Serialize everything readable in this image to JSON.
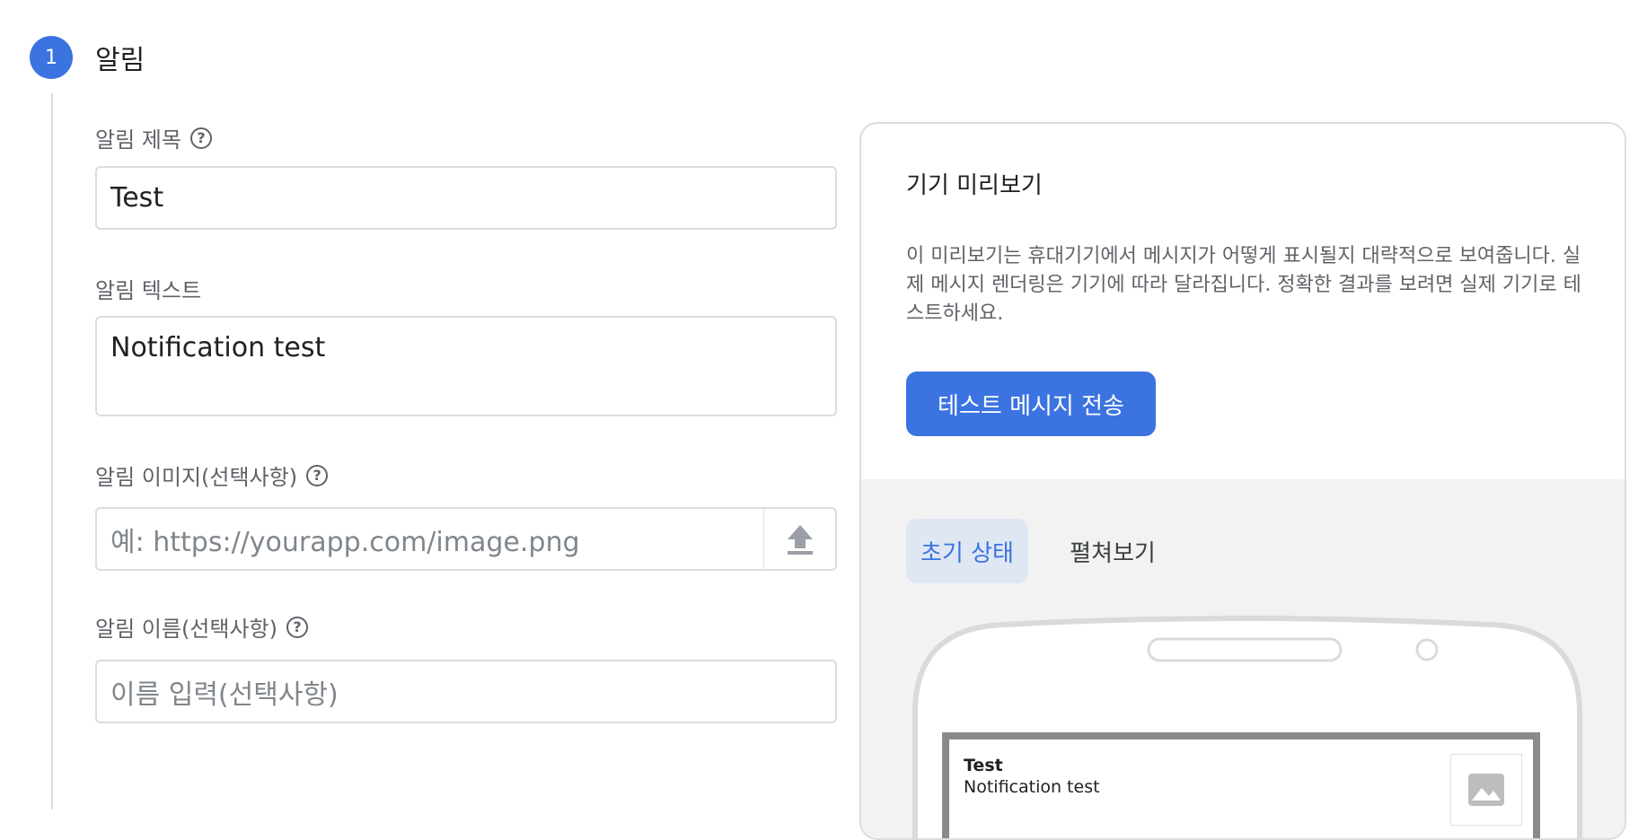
{
  "step": {
    "number": "1",
    "title": "알림"
  },
  "form": {
    "title_label": "알림 제목",
    "title_value": "Test",
    "text_label": "알림 텍스트",
    "text_value": "Notification test",
    "image_label": "알림 이미지(선택사항)",
    "image_placeholder": "예: https://yourapp.com/image.png",
    "name_label": "알림 이름(선택사항)",
    "name_placeholder": "이름 입력(선택사항)"
  },
  "preview": {
    "title": "기기 미리보기",
    "description": "이 미리보기는 휴대기기에서 메시지가 어떻게 표시될지 대략적으로 보여줍니다. 실제 메시지 렌더링은 기기에 따라 달라집니다. 정확한 결과를 보려면 실제 기기로 테스트하세요.",
    "send_button": "테스트 메시지 전송",
    "tabs": {
      "initial": "초기 상태",
      "expanded": "펼쳐보기"
    },
    "notification": {
      "title": "Test",
      "body": "Notification test"
    }
  },
  "colors": {
    "accent": "#3b73e1",
    "tab_selected_bg": "#dfe7f3",
    "preview_bg": "#f2f2f2"
  }
}
